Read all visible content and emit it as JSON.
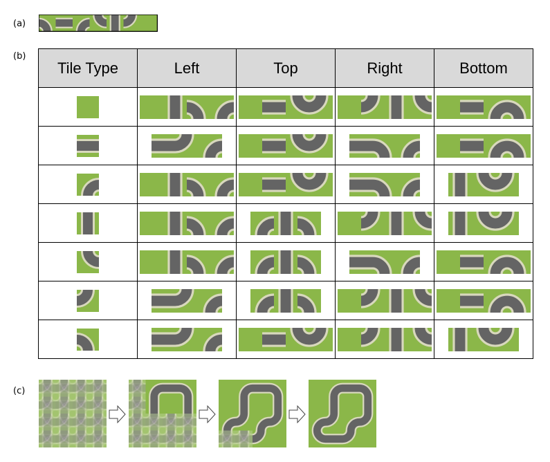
{
  "labels": {
    "a": "(a)",
    "b": "(b)",
    "c": "(c)"
  },
  "colors": {
    "grass": "#8bb749",
    "road": "#646464",
    "edge": "#d8d8bd",
    "header_bg": "#d9d9d9",
    "grid": "#000000"
  },
  "tileset": [
    "curve-nw",
    "straight-h",
    "curve-ne",
    "curve-sw",
    "straight-v",
    "curve-se",
    "grass"
  ],
  "table": {
    "headers": [
      "Tile Type",
      "Left",
      "Top",
      "Right",
      "Bottom"
    ],
    "rows": [
      {
        "tile": "grass",
        "left": [
          "grass",
          "straight-v",
          "curve-nw",
          "curve-ne"
        ],
        "top": [
          "grass",
          "straight-h",
          "curve-sw",
          "curve-se"
        ],
        "right": [
          "grass",
          "curve-se",
          "straight-v",
          "curve-sw"
        ],
        "bottom": [
          "grass",
          "straight-h",
          "curve-ne",
          "curve-nw"
        ]
      },
      {
        "tile": "straight-h",
        "left": [
          "straight-h",
          "curve-se",
          "curve-ne"
        ],
        "top": [
          "grass",
          "straight-h",
          "curve-sw",
          "curve-se"
        ],
        "right": [
          "straight-h",
          "curve-nw",
          "curve-ne"
        ],
        "bottom": [
          "grass",
          "straight-h",
          "curve-ne",
          "curve-nw"
        ]
      },
      {
        "tile": "curve-ne",
        "left": [
          "grass",
          "straight-v",
          "curve-nw",
          "curve-ne"
        ],
        "top": [
          "grass",
          "straight-h",
          "curve-sw",
          "curve-se"
        ],
        "right": [
          "straight-h",
          "curve-nw",
          "curve-ne"
        ],
        "bottom": [
          "straight-v",
          "curve-sw",
          "curve-se"
        ]
      },
      {
        "tile": "straight-v",
        "left": [
          "grass",
          "straight-v",
          "curve-nw",
          "curve-ne"
        ],
        "top": [
          "curve-ne",
          "straight-v",
          "curve-nw"
        ],
        "right": [
          "grass",
          "curve-se",
          "straight-v",
          "curve-sw"
        ],
        "bottom": [
          "straight-v",
          "curve-sw",
          "curve-se"
        ]
      },
      {
        "tile": "curve-sw",
        "left": [
          "grass",
          "straight-v",
          "curve-nw",
          "curve-ne"
        ],
        "top": [
          "curve-ne",
          "straight-v",
          "curve-nw"
        ],
        "right": [
          "straight-h",
          "curve-nw",
          "curve-ne"
        ],
        "bottom": [
          "grass",
          "straight-h",
          "curve-ne",
          "curve-nw"
        ]
      },
      {
        "tile": "curve-se",
        "left": [
          "straight-h",
          "curve-se",
          "curve-ne"
        ],
        "top": [
          "curve-ne",
          "straight-v",
          "curve-nw"
        ],
        "right": [
          "grass",
          "curve-se",
          "straight-v",
          "curve-sw"
        ],
        "bottom": [
          "grass",
          "straight-h",
          "curve-ne",
          "curve-nw"
        ]
      },
      {
        "tile": "curve-nw",
        "left": [
          "straight-h",
          "curve-se",
          "curve-ne"
        ],
        "top": [
          "grass",
          "straight-h",
          "curve-sw",
          "curve-se"
        ],
        "right": [
          "grass",
          "curve-se",
          "straight-v",
          "curve-sw"
        ],
        "bottom": [
          "straight-v",
          "curve-sw",
          "curve-se"
        ]
      }
    ]
  },
  "collapse_steps": [
    {
      "stage": "initial-superposition"
    },
    {
      "stage": "partially-collapsed"
    },
    {
      "stage": "mostly-collapsed"
    },
    {
      "stage": "fully-collapsed"
    }
  ]
}
